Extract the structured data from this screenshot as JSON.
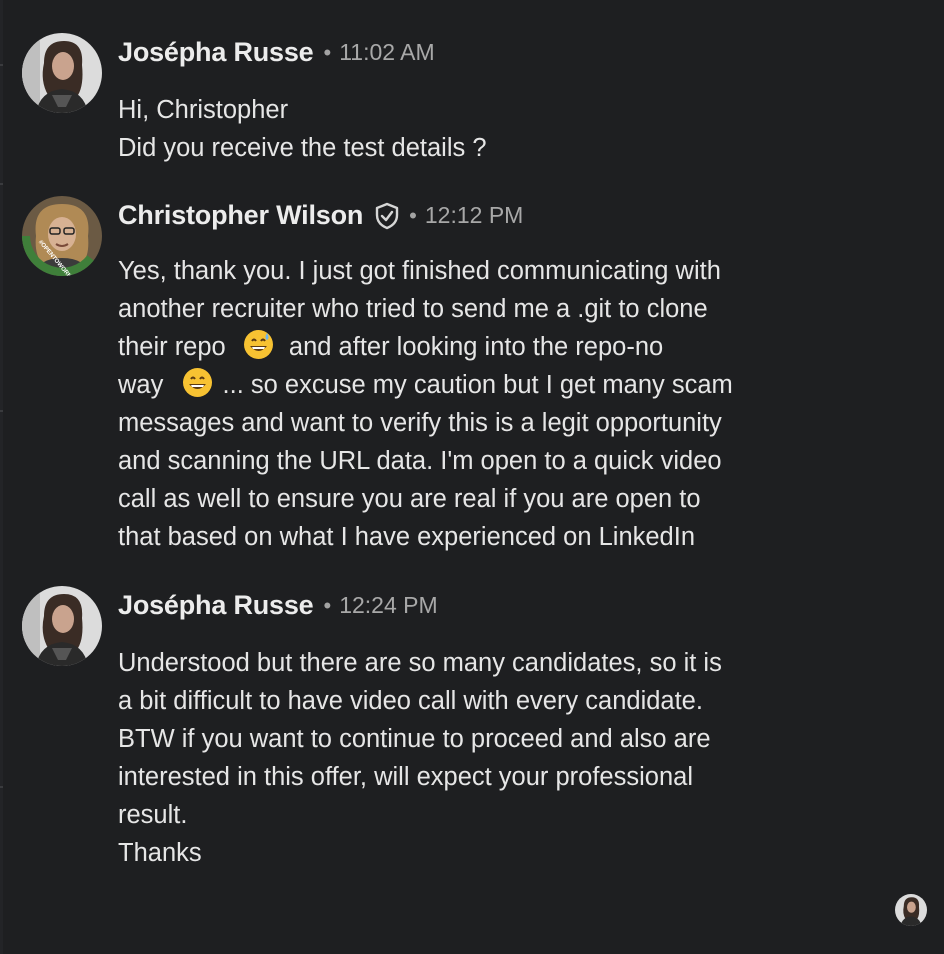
{
  "messages": [
    {
      "sender": "Josépha Russe",
      "separator": "•",
      "time": "11:02 AM",
      "avatar_icon": "avatar-josepha-icon",
      "lines": [
        "Hi, Christopher",
        "Did you receive the test details ?"
      ]
    },
    {
      "sender": "Christopher Wilson",
      "separator": "•",
      "time": "12:12 PM",
      "avatar_icon": "avatar-christopher-icon",
      "avatar_badge": "#OPENTOWORK",
      "verified_icon": "shield-check-icon",
      "lines": [
        "Yes, thank you. I just got finished communicating with",
        "another recruiter who tried to send me a .git to clone",
        "their repo",
        "and after looking into the repo-no",
        "way",
        "... so excuse my caution but I get many scam",
        "messages and want to verify this is a legit opportunity",
        "and scanning the URL data. I'm open to a quick video",
        "call as well to ensure you are real if you are open to",
        "that based on what I have experienced on LinkedIn"
      ],
      "emojis": [
        "grinning-sweat-emoji",
        "grinning-emoji"
      ]
    },
    {
      "sender": "Josépha Russe",
      "separator": "•",
      "time": "12:24 PM",
      "avatar_icon": "avatar-josepha-icon",
      "lines": [
        "Understood but there are so many candidates, so it is",
        "a bit difficult to have video call with every candidate.",
        "BTW if you want to continue to proceed and also are",
        "interested in this offer, will expect your professional",
        "result.",
        "Thanks"
      ]
    }
  ],
  "seen_indicator": {
    "icon": "seen-avatar-icon"
  },
  "colors": {
    "background": "#1e1f21",
    "text": "#e6e6e6",
    "secondary_text": "#a8a8a8",
    "open_to_work_green": "#3f7f3a"
  }
}
